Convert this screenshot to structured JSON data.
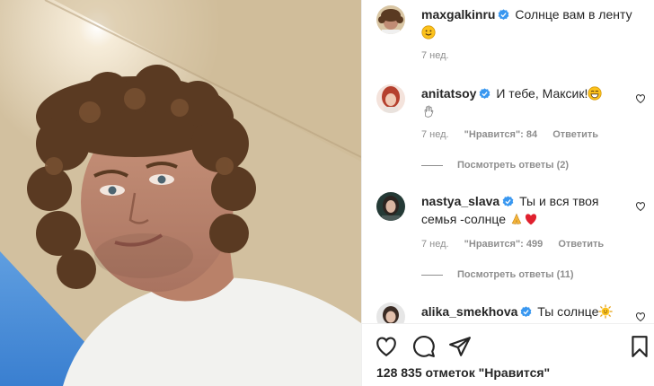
{
  "post": {
    "author": "maxgalkinru",
    "caption": "Солнце вам в ленту",
    "time": "7 нед."
  },
  "comments": [
    {
      "user": "anitatsoy",
      "text": "И тебе, Максик!",
      "time": "7 нед.",
      "likes": "\"Нравится\": 84",
      "reply": "Ответить",
      "view_replies": "Посмотреть ответы (2)"
    },
    {
      "user": "nastya_slava",
      "text": "Ты и вся твоя семья -солнце",
      "time": "7 нед.",
      "likes": "\"Нравится\": 499",
      "reply": "Ответить",
      "view_replies": "Посмотреть ответы (11)"
    },
    {
      "user": "alika_smekhova",
      "text": "Ты солнце"
    }
  ],
  "actions": {
    "like_icon": "heart-icon",
    "comment_icon": "comment-icon",
    "share_icon": "share-icon",
    "save_icon": "bookmark-icon"
  },
  "likes_count": "128 835 отметок \"Нравится\"",
  "colors": {
    "verified": "#3897f0",
    "text": "#262626",
    "muted": "#8e8e8e",
    "heart_red": "#ed4956"
  }
}
